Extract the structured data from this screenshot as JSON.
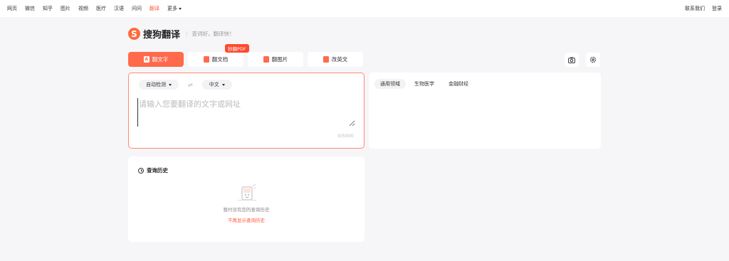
{
  "topnav": {
    "items": [
      "网页",
      "微信",
      "知乎",
      "图片",
      "视频",
      "医疗",
      "汉语",
      "问问",
      "翻译",
      "更多"
    ],
    "active_index": 8
  },
  "topright": {
    "contact": "联系我们",
    "login": "登录"
  },
  "logo": {
    "mark": "S",
    "name": "搜狗翻译",
    "slogan": "查词好，翻译快！"
  },
  "tabs": [
    {
      "label": "翻文字",
      "icon": "text-translate-icon",
      "active": true
    },
    {
      "label": "翻文档",
      "icon": "document-icon",
      "active": false,
      "badge": "秒翻PDF"
    },
    {
      "label": "翻图片",
      "icon": "image-icon",
      "active": false
    },
    {
      "label": "改英文",
      "icon": "edit-english-icon",
      "active": false
    }
  ],
  "tools": {
    "camera": "camera-icon",
    "settings": "gear-icon"
  },
  "source": {
    "from_lang": "自动检测",
    "to_lang": "中文",
    "placeholder": "请输入您要翻译的文字或网址",
    "value": "",
    "counter": "0/5000"
  },
  "target": {
    "domains": [
      "通用领域",
      "生物医学",
      "金融财经"
    ],
    "active_domain": 0
  },
  "history": {
    "title": "查询历史",
    "empty_text": "暂时没有您的查询历史",
    "hide_link": "不再显示查询历史"
  },
  "colors": {
    "accent": "#ff6a4d",
    "active_text": "#ff5a3b",
    "background": "#f6f6f8"
  }
}
